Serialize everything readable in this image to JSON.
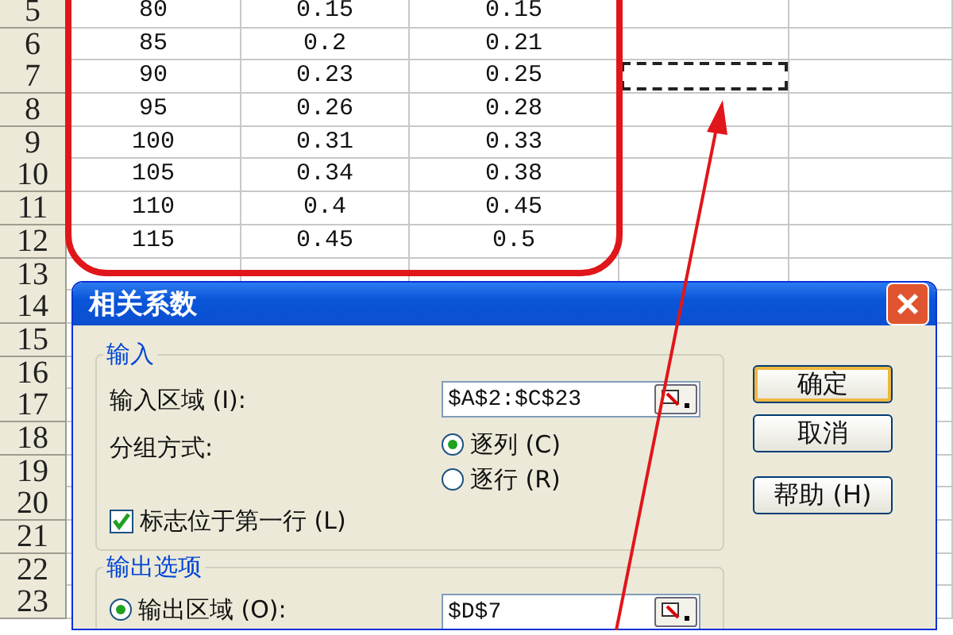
{
  "sheet": {
    "rows": [
      {
        "header": "5",
        "cells": [
          "80",
          "0.15",
          "0.15"
        ],
        "marquee": false
      },
      {
        "header": "6",
        "cells": [
          "85",
          "0.2",
          "0.21"
        ],
        "marquee": false
      },
      {
        "header": "7",
        "cells": [
          "90",
          "0.23",
          "0.25"
        ],
        "marquee": true
      },
      {
        "header": "8",
        "cells": [
          "95",
          "0.26",
          "0.28"
        ],
        "marquee": false
      },
      {
        "header": "9",
        "cells": [
          "100",
          "0.31",
          "0.33"
        ],
        "marquee": false
      },
      {
        "header": "10",
        "cells": [
          "105",
          "0.34",
          "0.38"
        ],
        "marquee": false
      },
      {
        "header": "11",
        "cells": [
          "110",
          "0.4",
          "0.45"
        ],
        "marquee": false
      },
      {
        "header": "12",
        "cells": [
          "115",
          "0.45",
          "0.5"
        ],
        "marquee": false
      },
      {
        "header": "13",
        "marquee": false
      },
      {
        "header": "14"
      },
      {
        "header": "15"
      },
      {
        "header": "16"
      },
      {
        "header": "17"
      },
      {
        "header": "18"
      },
      {
        "header": "19"
      },
      {
        "header": "20"
      },
      {
        "header": "21"
      },
      {
        "header": "22"
      },
      {
        "header": "23"
      }
    ]
  },
  "annotations": {
    "frame": true,
    "arrow": true
  },
  "dialog": {
    "title": "相关系数",
    "input_group": {
      "legend": "输入",
      "range_label": "输入区域 (I):",
      "range_value": "$A$2:$C$23",
      "grouping_label": "分组方式:",
      "grouping_options": [
        {
          "label": "逐列 (C)",
          "selected": true
        },
        {
          "label": "逐行 (R)",
          "selected": false
        }
      ],
      "labels_checkbox": {
        "label": "标志位于第一行 (L)",
        "checked": true
      }
    },
    "buttons": [
      {
        "label": "确定",
        "default": true
      },
      {
        "label": "取消",
        "default": false
      },
      {
        "label": "帮助 (H)",
        "default": false
      }
    ],
    "output_group": {
      "legend": "输出选项",
      "options": [
        {
          "label": "输出区域 (O):",
          "selected": true,
          "value": "$D$7"
        }
      ]
    }
  }
}
